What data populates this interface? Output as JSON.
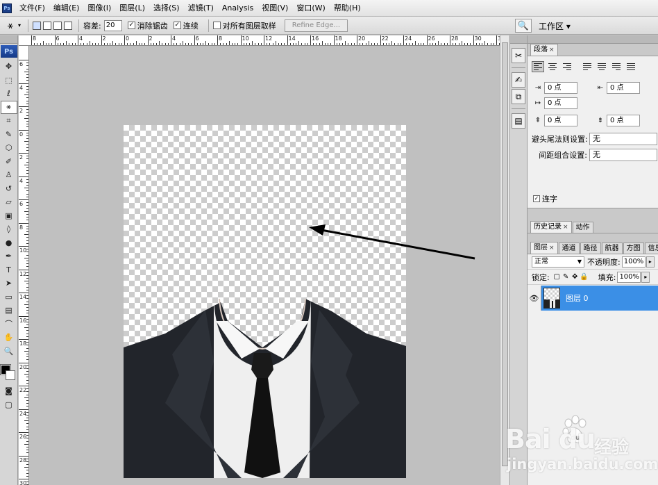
{
  "app": {
    "logo_text": "Ps",
    "menu": [
      "文件(F)",
      "编辑(E)",
      "图像(I)",
      "图层(L)",
      "选择(S)",
      "滤镜(T)",
      "Analysis",
      "视图(V)",
      "窗口(W)",
      "帮助(H)"
    ]
  },
  "options": {
    "tolerance_label": "容差:",
    "tolerance_value": "20",
    "anti_alias_label": "消除锯齿",
    "anti_alias_checked": true,
    "contiguous_label": "连续",
    "contiguous_checked": true,
    "sample_all_label": "对所有图层取样",
    "sample_all_checked": false,
    "refine_edge_label": "Refine Edge...",
    "workspace_label": "工作区 ▾"
  },
  "rulers": {
    "horizontal": [
      "8",
      "6",
      "4",
      "2",
      "0",
      "2",
      "4",
      "6",
      "8",
      "10",
      "12",
      "14",
      "16",
      "18",
      "20",
      "22",
      "24",
      "26",
      "28",
      "30",
      "32"
    ],
    "vertical": [
      "6",
      "4",
      "2",
      "0",
      "2",
      "4",
      "6",
      "8",
      "10",
      "12",
      "14",
      "16",
      "18",
      "20",
      "22",
      "24",
      "26",
      "28",
      "30"
    ]
  },
  "paragraph_panel": {
    "tab": "段落",
    "indent_left": "0 点",
    "indent_right": "0 点",
    "indent_first": "0 点",
    "space_before": "0 点",
    "space_after": "0 点",
    "kinsoku_label": "避头尾法则设置:",
    "kinsoku_value": "无",
    "mojikumi_label": "间距组合设置:",
    "mojikumi_value": "无",
    "hyphenate_label": "连字",
    "hyphenate_checked": true
  },
  "history_panel": {
    "tabs": [
      "历史记录",
      "动作"
    ]
  },
  "layers_panel": {
    "tabs": [
      "图层",
      "通道",
      "路径",
      "航器",
      "方图",
      "信息"
    ],
    "blend_mode": "正常",
    "opacity_label": "不透明度:",
    "opacity_value": "100%",
    "lock_label": "锁定:",
    "fill_label": "填充:",
    "fill_value": "100%",
    "layers": [
      {
        "name": "图层 0",
        "visible": true,
        "selected": true
      }
    ]
  },
  "watermark": {
    "brand": "Bai  du",
    "product": "经验",
    "url": "jingyan.baidu.com"
  },
  "colors": {
    "selection_blue": "#3b8fe6",
    "canvas_bg": "#c0c0c0",
    "suit": "#22252b"
  }
}
